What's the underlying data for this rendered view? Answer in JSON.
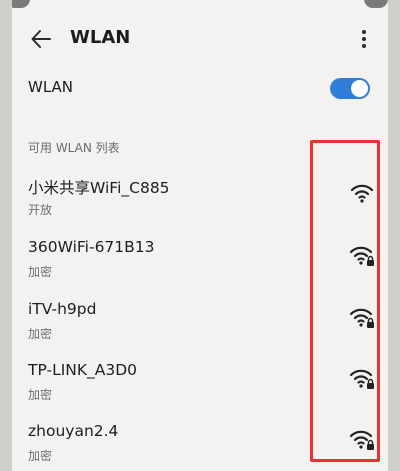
{
  "header": {
    "title": "WLAN",
    "back_icon": "back-arrow-icon",
    "more_icon": "more-vertical-icon"
  },
  "wlan_toggle": {
    "label": "WLAN",
    "on": true,
    "color": "#2f7ed8"
  },
  "section": {
    "title": "可用 WLAN 列表"
  },
  "networks": [
    {
      "name": "小米共享WiFi_C885",
      "security": "开放",
      "icon": "wifi-open-icon"
    },
    {
      "name": "360WiFi-671B13",
      "security": "加密",
      "icon": "wifi-locked-icon"
    },
    {
      "name": "iTV-h9pd",
      "security": "加密",
      "icon": "wifi-locked-icon"
    },
    {
      "name": "TP-LINK_A3D0",
      "security": "加密",
      "icon": "wifi-locked-icon"
    },
    {
      "name": "zhouyan2.4",
      "security": "加密",
      "icon": "wifi-locked-icon"
    }
  ],
  "annotation": {
    "color": "#ef2f2f"
  }
}
